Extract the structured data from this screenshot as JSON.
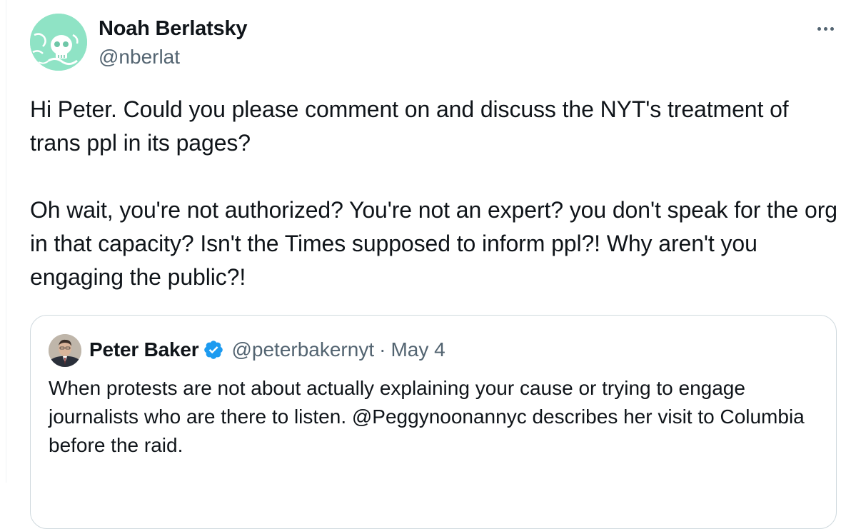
{
  "tweet": {
    "author": {
      "display_name": "Noah Berlatsky",
      "handle": "@nberlat",
      "avatar_icon": "skull-illustration-avatar",
      "avatar_color": "#8fe3c5"
    },
    "more_icon": "more-horizontal-icon",
    "text": "Hi Peter. Could you please comment on and discuss the NYT's treatment of trans ppl in its pages?\n\nOh wait, you're not authorized? You're not an expert? you don't speak for the org in that capacity? Isn't the Times supposed to inform ppl?! Why aren't you engaging the public?!"
  },
  "quoted_tweet": {
    "author": {
      "display_name": "Peter Baker",
      "handle": "@peterbakernyt",
      "verified": true,
      "verified_color": "#1d9bf0"
    },
    "separator": "·",
    "date": "May 4",
    "text": "When protests are not about actually explaining your cause or trying to engage journalists who are there to listen. @Peggynoonannyc describes her visit to Columbia before the raid."
  }
}
